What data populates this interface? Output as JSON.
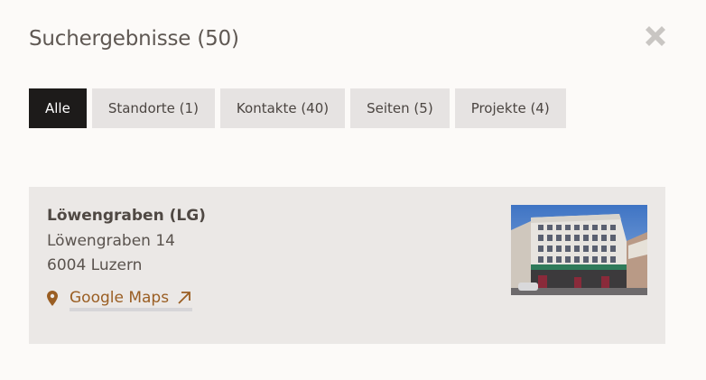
{
  "modal": {
    "title": "Suchergebnisse (50)",
    "close_icon": "close-icon"
  },
  "tabs": [
    {
      "label": "Alle",
      "active": true
    },
    {
      "label": "Standorte (1)",
      "active": false
    },
    {
      "label": "Kontakte (40)",
      "active": false
    },
    {
      "label": "Seiten (5)",
      "active": false
    },
    {
      "label": "Projekte (4)",
      "active": false
    }
  ],
  "result": {
    "name": "Löwengraben (LG)",
    "street": "Löwengraben 14",
    "city": "6004 Luzern",
    "maps_label": "Google Maps",
    "maps_icon": "map-pin-icon",
    "external_icon": "external-link-icon",
    "image": "building-photo"
  },
  "colors": {
    "background": "#fcfaf8",
    "tab_active_bg": "#1d1b1a",
    "tab_bg": "#e6e3e2",
    "card_bg": "#ebe8e6",
    "link": "#9a5e23",
    "close": "#c9c6c3"
  }
}
